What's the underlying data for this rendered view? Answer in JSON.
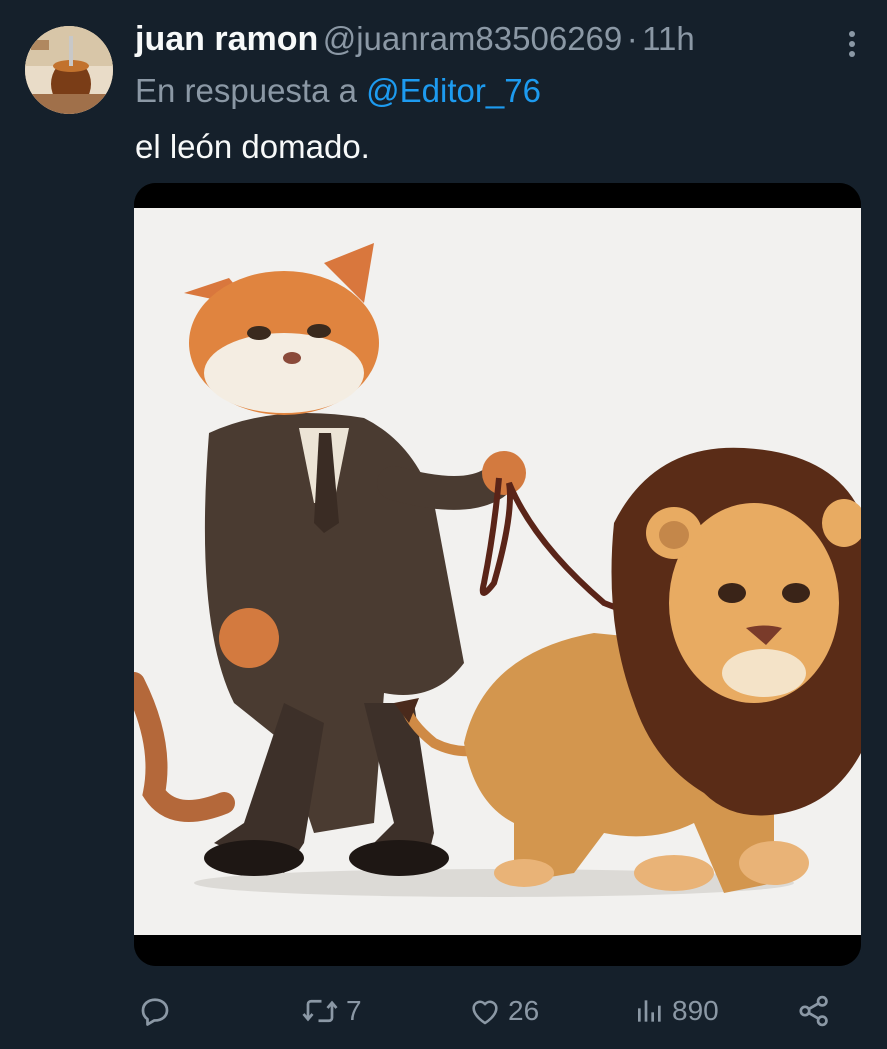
{
  "tweet": {
    "author_name": "juan ramon",
    "handle": "@juanram83506269",
    "separator": "·",
    "time": "11h",
    "reply_prefix": "En respuesta a",
    "reply_to": "@Editor_76",
    "text": "el león domado."
  },
  "media": {
    "icon": "illustration-cat-walking-lion-on-leash"
  },
  "actions": {
    "reply_count": "",
    "retweet_count": "7",
    "like_count": "26",
    "view_count": "890"
  },
  "colors": {
    "background": "#15202b",
    "primary_text": "#f7f9f9",
    "secondary_text": "#8b98a5",
    "accent": "#1d9bf0"
  }
}
